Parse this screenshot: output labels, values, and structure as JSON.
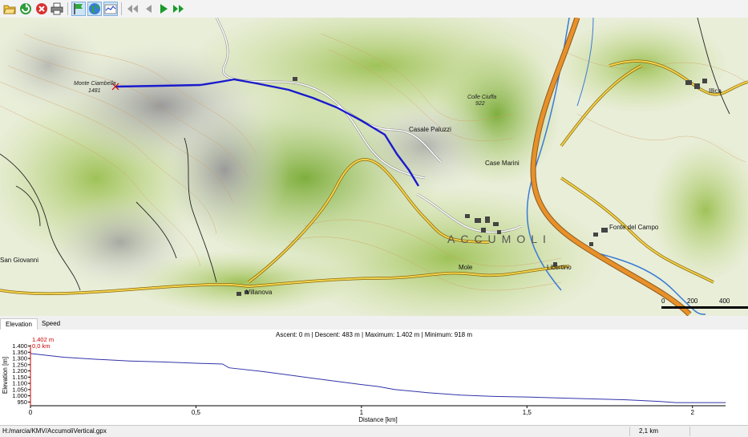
{
  "toolbar": {
    "icons": [
      "open-icon",
      "reload-icon",
      "close-icon",
      "print-icon",
      "flag-icon",
      "globe-icon",
      "chart-icon",
      "first-icon",
      "prev-icon",
      "play-icon",
      "last-icon"
    ]
  },
  "map": {
    "labels": {
      "monte_ciambella": "Monte Ciambella",
      "monte_ciambella_alt": "1481",
      "colle_ciuffa": "Colle Ciuffa",
      "colle_ciuffa_alt": "922",
      "casale_paluzzi": "Casale Paluzzi",
      "case_marini": "Case Marini",
      "accumoli": "ACCUMOLI",
      "fonte_del_campo": "Fonte del Campo",
      "illica": "Illica",
      "san_giovanni": "San Giovanni",
      "villanova": "Villanova",
      "mole": "Mole",
      "libertino": "Libertino"
    },
    "scale": {
      "labels": [
        "0",
        "200",
        "400"
      ]
    },
    "colors": {
      "track": "#1a1acc",
      "highway": "#e8902a",
      "road": "#e0c040",
      "river": "#3a7bd5"
    }
  },
  "tabs": [
    {
      "label": "Elevation",
      "active": true
    },
    {
      "label": "Speed",
      "active": false
    }
  ],
  "chart_data": {
    "type": "line",
    "title": "Ascent: 0 m | Descent: 483 m | Maximum: 1.402 m | Minimum: 918 m",
    "xlabel": "Distance [km]",
    "ylabel": "Elevation [m]",
    "xlim": [
      0,
      2.1
    ],
    "ylim": [
      918,
      1402
    ],
    "x_ticks": [
      "0",
      "0,5",
      "1",
      "1,5",
      "2"
    ],
    "y_ticks": [
      "950",
      "1.000",
      "1.050",
      "1.100",
      "1.150",
      "1.200",
      "1.250",
      "1.300",
      "1.350",
      "1.400"
    ],
    "cursor_labels": {
      "elevation": "1.402 m",
      "distance": "0,0 km"
    },
    "series": [
      {
        "x": [
          0,
          0.1,
          0.2,
          0.3,
          0.4,
          0.5,
          0.58,
          0.6,
          0.7,
          0.8,
          0.9,
          1.0,
          1.05,
          1.1,
          1.2,
          1.3,
          1.4,
          1.5,
          1.6,
          1.7,
          1.8,
          1.9,
          1.95,
          2.0,
          2.1
        ],
        "y": [
          1340,
          1310,
          1293,
          1280,
          1272,
          1262,
          1255,
          1225,
          1195,
          1160,
          1125,
          1090,
          1075,
          1050,
          1025,
          1005,
          995,
          990,
          982,
          975,
          968,
          955,
          945,
          945,
          945
        ],
        "color": "#3333aa"
      }
    ]
  },
  "status": {
    "path": "H:/marcia/KMV/AccumoliVertical.gpx",
    "distance": "2,1 km"
  }
}
